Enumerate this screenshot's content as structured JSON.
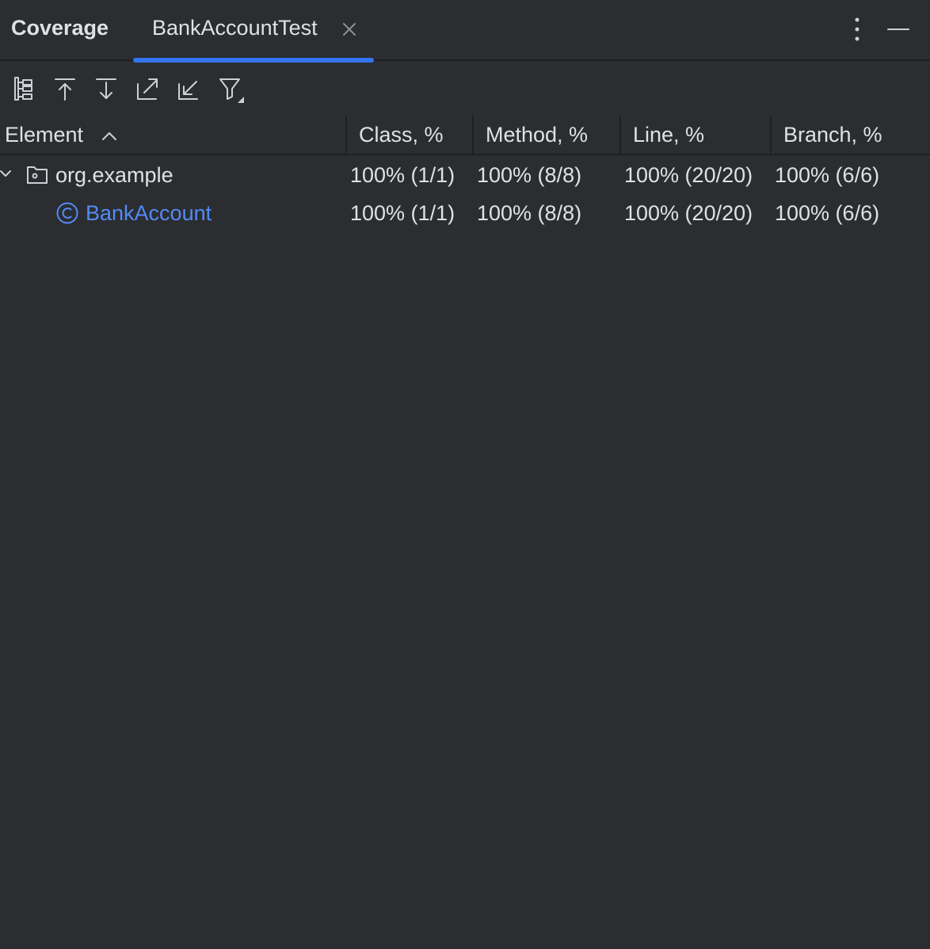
{
  "header": {
    "title": "Coverage",
    "tab_label": "BankAccountTest"
  },
  "toolbar": {
    "buttons": [
      "flatten-packages-icon",
      "go-up-icon",
      "go-down-icon",
      "navigate-out-icon",
      "navigate-in-icon",
      "filter-icon"
    ]
  },
  "table": {
    "columns": [
      "Element",
      "Class, %",
      "Method, %",
      "Line, %",
      "Branch, %"
    ],
    "sort_column": "Element",
    "rows": [
      {
        "name": "org.example",
        "kind": "package",
        "expanded": true,
        "class": "100% (1/1)",
        "method": "100% (8/8)",
        "line": "100% (20/20)",
        "branch": "100% (6/6)"
      },
      {
        "name": "BankAccount",
        "kind": "class",
        "class": "100% (1/1)",
        "method": "100% (8/8)",
        "line": "100% (20/20)",
        "branch": "100% (6/6)"
      }
    ]
  },
  "colors": {
    "background": "#2b2d30",
    "accent": "#3574f0",
    "link": "#548af7",
    "text": "#dfe1e5"
  }
}
